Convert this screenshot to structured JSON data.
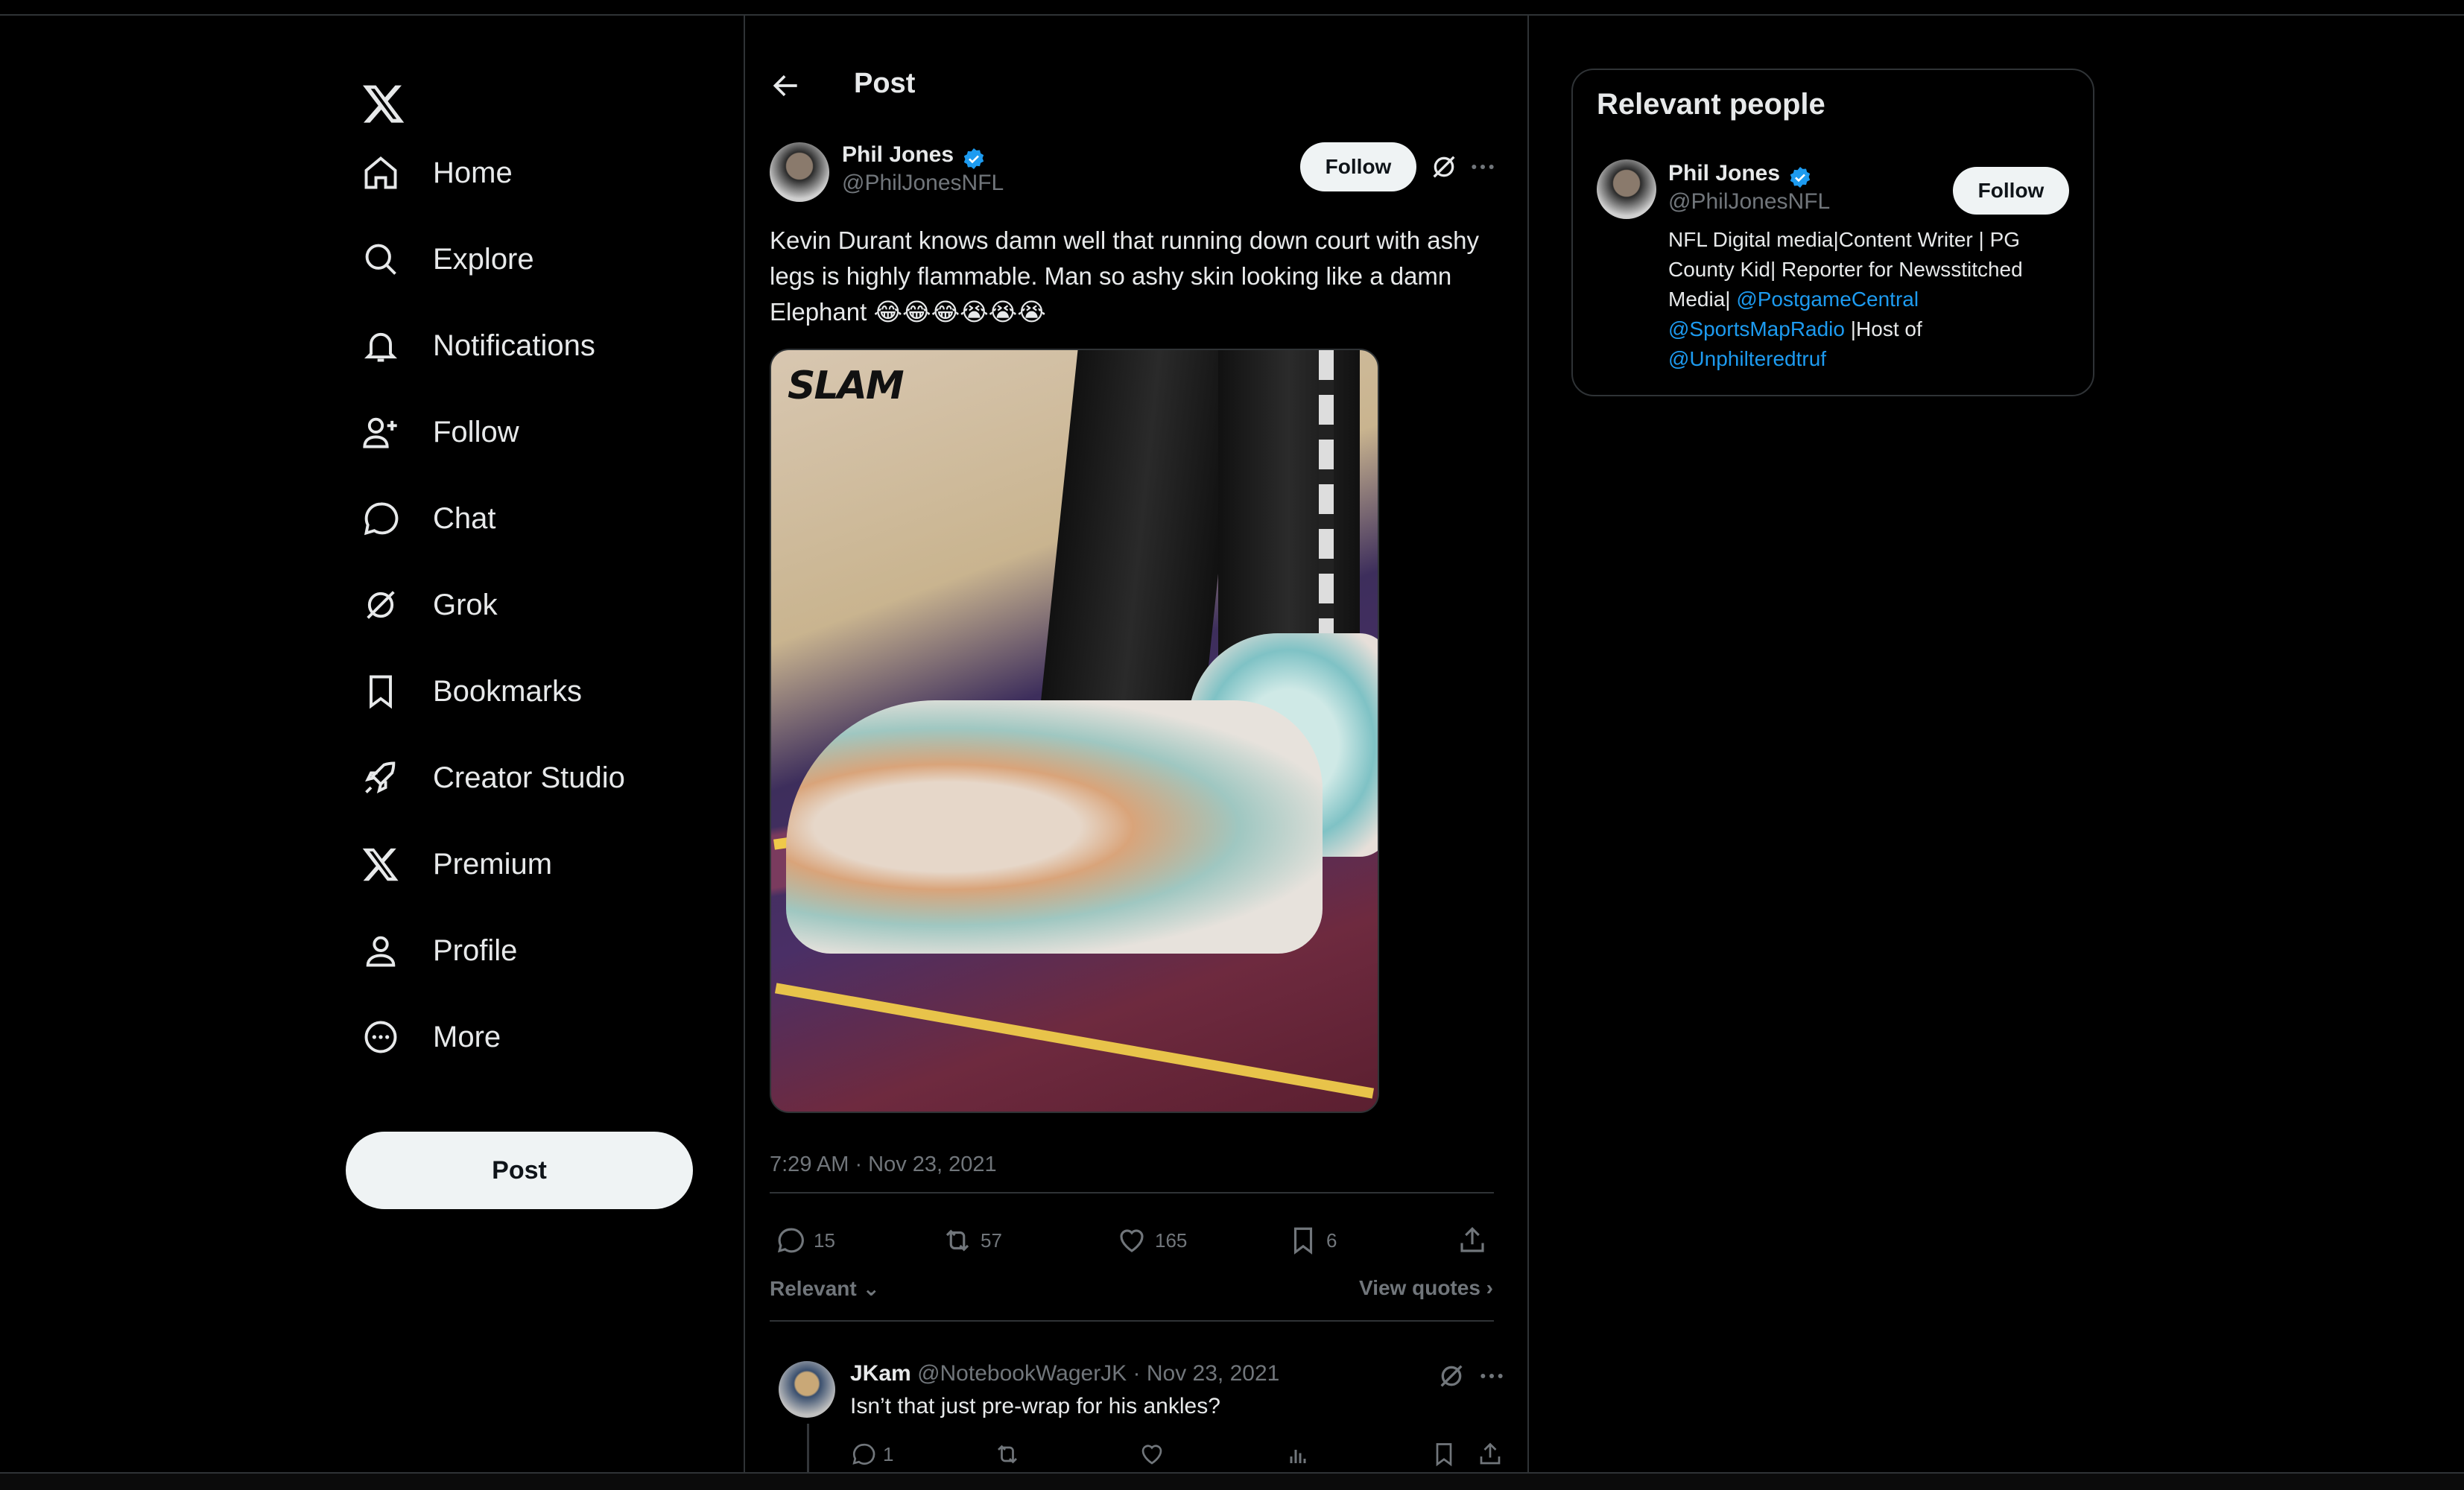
{
  "sidebar": {
    "items": [
      {
        "label": "Home",
        "icon": "home-icon"
      },
      {
        "label": "Explore",
        "icon": "search-icon"
      },
      {
        "label": "Notifications",
        "icon": "bell-icon"
      },
      {
        "label": "Follow",
        "icon": "add-person-icon"
      },
      {
        "label": "Chat",
        "icon": "chat-bubble-icon"
      },
      {
        "label": "Grok",
        "icon": "grok-icon"
      },
      {
        "label": "Bookmarks",
        "icon": "bookmark-icon"
      },
      {
        "label": "Creator Studio",
        "icon": "rocket-icon"
      },
      {
        "label": "Premium",
        "icon": "x-logo-icon"
      },
      {
        "label": "Profile",
        "icon": "person-icon"
      },
      {
        "label": "More",
        "icon": "more-circle-icon"
      }
    ],
    "post_label": "Post"
  },
  "main": {
    "header_title": "Post",
    "tweet": {
      "author_name": "Phil Jones",
      "author_handle": "@PhilJonesNFL",
      "follow_label": "Follow",
      "text": "Kevin Durant knows damn well that running down court with ashy legs is highly flammable. Man so ashy skin looking like a damn Elephant 😂😂😂😭😭😭",
      "media_logo": "SLAM",
      "timestamp": "7:29 AM · Nov 23, 2021",
      "replies": "15",
      "reposts": "57",
      "likes": "165",
      "bookmarks": "6",
      "sort_label": "Relevant",
      "view_quotes_label": "View quotes"
    },
    "reply": {
      "author_name": "JKam",
      "author_handle": "@NotebookWagerJK · Nov 23, 2021",
      "text": "Isn’t that just pre-wrap for his ankles?",
      "replies": "1"
    }
  },
  "right_panel": {
    "title": "Relevant people",
    "person": {
      "name": "Phil Jones",
      "handle": "@PhilJonesNFL",
      "follow_label": "Follow",
      "bio_line1": "NFL Digital media|Content Writer | PG County Kid| Reporter for Newsstitched Media| ",
      "mention1": "@PostgameCentral",
      "mention2": "@SportsMapRadio",
      "bio_line2": " |Host of ",
      "mention3": "@Unphilteredtruf"
    }
  },
  "colors": {
    "background": "#000000",
    "text": "#e7e9ea",
    "muted": "#71767b",
    "accent": "#1d9bf0",
    "border": "#2f3336",
    "button": "#eff3f4"
  }
}
